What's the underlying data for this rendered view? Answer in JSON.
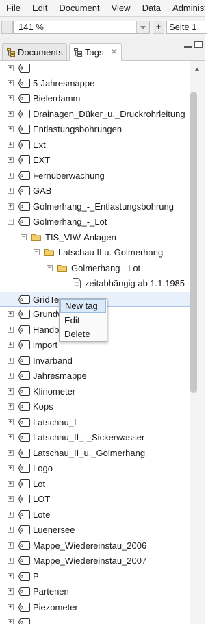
{
  "menubar": {
    "items": [
      "File",
      "Edit",
      "Document",
      "View",
      "Data",
      "Administ"
    ]
  },
  "toolbar": {
    "zoom_out_label": "-",
    "zoom_value": "141 %",
    "zoom_in_label": "+",
    "page_value": "Seite 1"
  },
  "tabs": {
    "documents_label": "Documents",
    "tags_label": "Tags",
    "close_glyph": "✕"
  },
  "tree": {
    "rows": [
      {
        "label": ""
      },
      {
        "label": "5-Jahresmappe"
      },
      {
        "label": "Bielerdamm"
      },
      {
        "label": "Drainagen_Düker_u._Druckrohrleitung"
      },
      {
        "label": "Entlastungsbohrungen"
      },
      {
        "label": "Ext"
      },
      {
        "label": "EXT"
      },
      {
        "label": "Fernüberwachung"
      },
      {
        "label": "GAB"
      },
      {
        "label": "Golmerhang_-_Entlastungsbohrung"
      },
      {
        "label": "Golmerhang_-_Lot"
      },
      {
        "label": "TIS_VIW-Anlagen"
      },
      {
        "label": "Latschau II u. Golmerhang"
      },
      {
        "label": "Golmerhang - Lot"
      },
      {
        "label": "zeitabhängig ab 1.1.1985"
      },
      {
        "label": "GridTe"
      },
      {
        "label": "Grundw"
      },
      {
        "label": "Handb"
      },
      {
        "label": "import"
      },
      {
        "label": "Invarband"
      },
      {
        "label": "Jahresmappe"
      },
      {
        "label": "Klinometer"
      },
      {
        "label": "Kops"
      },
      {
        "label": "Latschau_I"
      },
      {
        "label": "Latschau_II_-_Sickerwasser"
      },
      {
        "label": "Latschau_II_u._Golmerhang"
      },
      {
        "label": "Logo"
      },
      {
        "label": "Lot"
      },
      {
        "label": "LOT"
      },
      {
        "label": "Lote"
      },
      {
        "label": "Luenersee"
      },
      {
        "label": "Mappe_Wiedereinstau_2006"
      },
      {
        "label": "Mappe_Wiedereinstau_2007"
      },
      {
        "label": "P"
      },
      {
        "label": "Partenen"
      },
      {
        "label": "Piezometer"
      }
    ]
  },
  "context_menu": {
    "items": [
      "New tag",
      "Edit",
      "Delete"
    ]
  },
  "colors": {
    "selected_row": "#e8f0fb",
    "menu_hover": "#dce9f8",
    "folder": "#e8c25a"
  }
}
